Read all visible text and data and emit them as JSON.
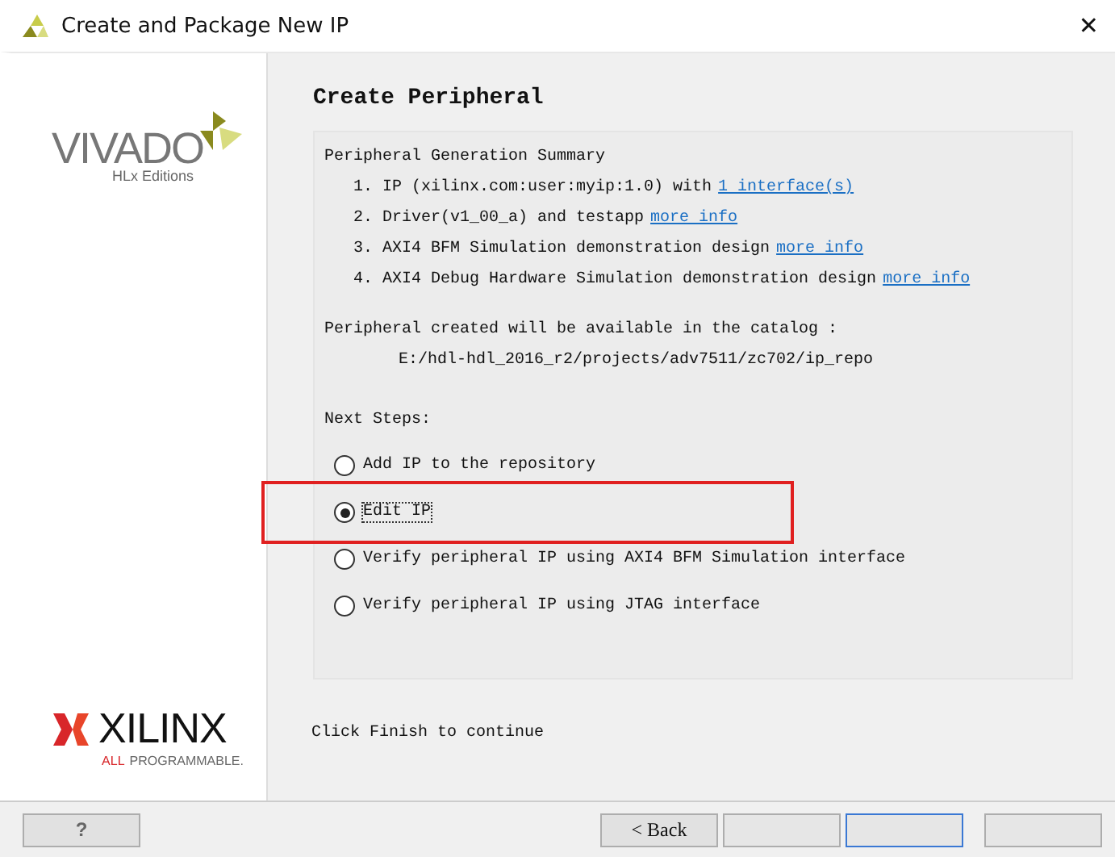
{
  "window": {
    "title": "Create and Package New IP",
    "close": "✕"
  },
  "branding": {
    "product": "VIVADO",
    "edition": "HLx Editions",
    "company": "XILINX",
    "tagline_accent": "ALL",
    "tagline": "PROGRAMMABLE."
  },
  "page": {
    "heading": "Create Peripheral",
    "summary_title": "Peripheral Generation Summary",
    "summary_items": [
      {
        "number": "1.",
        "text": "IP (xilinx.com:user:myip:1.0) with",
        "link": "1 interface(s)"
      },
      {
        "number": "2.",
        "text": "Driver(v1_00_a) and testapp",
        "link": "more info"
      },
      {
        "number": "3.",
        "text": "AXI4 BFM Simulation demonstration design",
        "link": "more info"
      },
      {
        "number": "4.",
        "text": "AXI4 Debug Hardware Simulation demonstration design",
        "link": "more info"
      }
    ],
    "catalog_note": "Peripheral created will be available in the catalog :",
    "catalog_path": "E:/hdl-hdl_2016_r2/projects/adv7511/zc702/ip_repo",
    "next_steps_label": "Next Steps:",
    "options": [
      {
        "label": "Add IP to the repository",
        "selected": false,
        "highlighted": false
      },
      {
        "label": "Edit IP",
        "selected": true,
        "highlighted": true
      },
      {
        "label": "Verify peripheral IP using AXI4 BFM Simulation interface",
        "selected": false,
        "highlighted": false
      },
      {
        "label": "Verify peripheral IP using JTAG interface",
        "selected": false,
        "highlighted": false
      }
    ],
    "footer_note": "Click Finish to continue"
  },
  "buttons": {
    "help": "?",
    "back": "< Back"
  }
}
